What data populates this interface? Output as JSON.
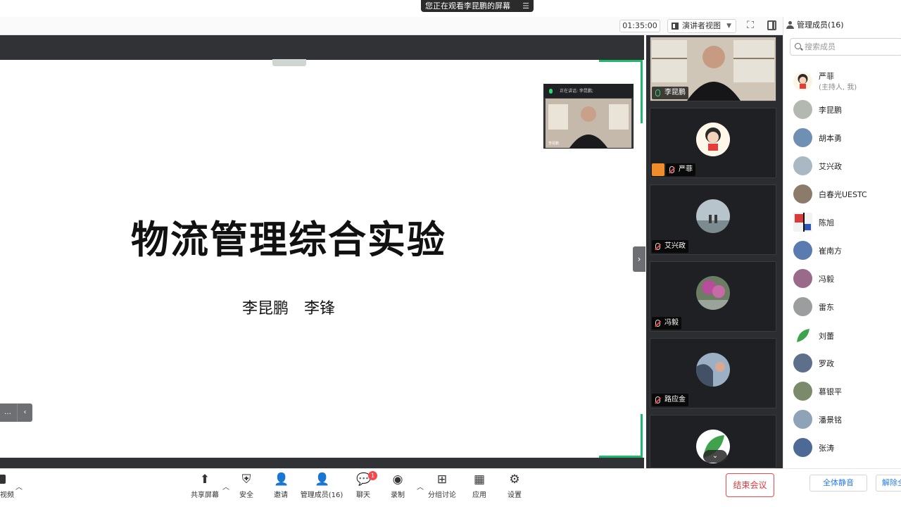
{
  "banner": {
    "text": "您正在观看李昆鹏的屏幕",
    "menu_icon": "list-icon"
  },
  "toolbar": {
    "timer": "01:35:00",
    "view_label": "演讲者视图"
  },
  "slide": {
    "title": "物流管理综合实验",
    "authors": "李昆鹏　李锋",
    "nav_dots": "…"
  },
  "speaker_float": {
    "header": "正在讲话: 李昆鹏;",
    "name": "李昆鹏"
  },
  "video_tiles": [
    {
      "name": "李昆鹏",
      "mic": "on"
    },
    {
      "name": "严菲",
      "mic": "off",
      "host": true
    },
    {
      "name": "艾兴政",
      "mic": "off"
    },
    {
      "name": "冯毅",
      "mic": "off"
    },
    {
      "name": "路应金",
      "mic": "off"
    },
    {
      "name": "",
      "mic": "off"
    }
  ],
  "bottom_toolbar": {
    "left_label": "视频",
    "items": [
      {
        "label": "共享屏幕",
        "icon": "share-screen-icon"
      },
      {
        "label": "安全",
        "icon": "shield-icon"
      },
      {
        "label": "邀请",
        "icon": "invite-icon"
      },
      {
        "label": "管理成员(16)",
        "icon": "members-icon"
      },
      {
        "label": "聊天",
        "icon": "chat-icon",
        "badge": "1"
      },
      {
        "label": "录制",
        "icon": "record-icon"
      },
      {
        "label": "分组讨论",
        "icon": "breakout-icon"
      },
      {
        "label": "应用",
        "icon": "apps-icon"
      },
      {
        "label": "设置",
        "icon": "gear-icon"
      }
    ],
    "end_meeting": "结束会议"
  },
  "panel": {
    "title": "管理成员(16)",
    "search_placeholder": "搜索成员",
    "members": [
      {
        "name": "严菲",
        "sub": "(主持人, 我)"
      },
      {
        "name": "李昆鹏"
      },
      {
        "name": "胡本勇"
      },
      {
        "name": "艾兴政"
      },
      {
        "name": "白春光UESTC"
      },
      {
        "name": "陈旭"
      },
      {
        "name": "崔南方"
      },
      {
        "name": "冯毅"
      },
      {
        "name": "雷东"
      },
      {
        "name": "刘蕾"
      },
      {
        "name": "罗政"
      },
      {
        "name": "慕银平"
      },
      {
        "name": "潘景铭"
      },
      {
        "name": "张涛"
      }
    ],
    "mute_all": "全体静音",
    "unmute_all": "解除全"
  },
  "colors": {
    "accent_green": "#1fb86d",
    "danger_red": "#f5484d",
    "link_blue": "#2c7be5"
  }
}
